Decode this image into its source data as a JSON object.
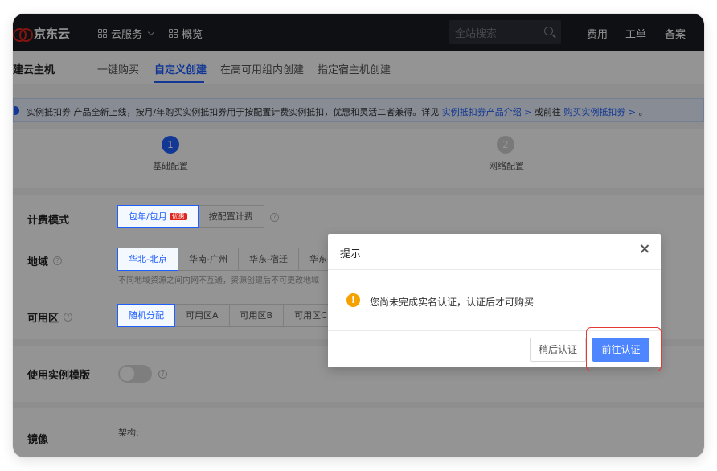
{
  "topbar": {
    "logo": "京东云",
    "nav": [
      {
        "label": "云服务",
        "icon": "grid-icon"
      },
      {
        "label": "概览",
        "icon": "grid-icon"
      }
    ],
    "search_placeholder": "全站搜索",
    "links": [
      "费用",
      "工单",
      "备案"
    ]
  },
  "subnav": {
    "page_title": "建云主机",
    "tabs": [
      "一键购买",
      "自定义创建",
      "在高可用组内创建",
      "指定宿主机创建"
    ],
    "active_tab": "自定义创建"
  },
  "notice": {
    "text": "实例抵扣券 产品全新上线，按月/年购买实例抵扣券用于按配置计费实例抵扣，优惠和灵活二者兼得。详见",
    "link1": "实例抵扣券产品介绍 >",
    "middle": "或前往",
    "link2": "购买实例抵扣券 >",
    "end": "。"
  },
  "steps": [
    {
      "num": "1",
      "label": "基础配置",
      "active": true
    },
    {
      "num": "2",
      "label": "网络配置",
      "active": false
    }
  ],
  "form": {
    "billing": {
      "label": "计费模式",
      "options": [
        "包年/包月",
        "按配置计费"
      ],
      "badge": "优惠",
      "selected": "包年/包月"
    },
    "region": {
      "label": "地域",
      "options": [
        "华北-北京",
        "华南-广州",
        "华东-宿迁",
        "华东-"
      ],
      "selected": "华北-北京",
      "hint": "不同地域资源之间内网不互通，资源创建后不可更改地域"
    },
    "zone": {
      "label": "可用区",
      "options": [
        "随机分配",
        "可用区A",
        "可用区B",
        "可用区C"
      ],
      "selected": "随机分配"
    },
    "template": {
      "label": "使用实例模版",
      "enabled": false
    },
    "image": {
      "label": "镜像",
      "arch_label": "架构:"
    }
  },
  "dialog": {
    "title": "提示",
    "message": "您尚未完成实名认证，认证后才可购买",
    "cancel": "稍后认证",
    "confirm": "前往认证"
  }
}
